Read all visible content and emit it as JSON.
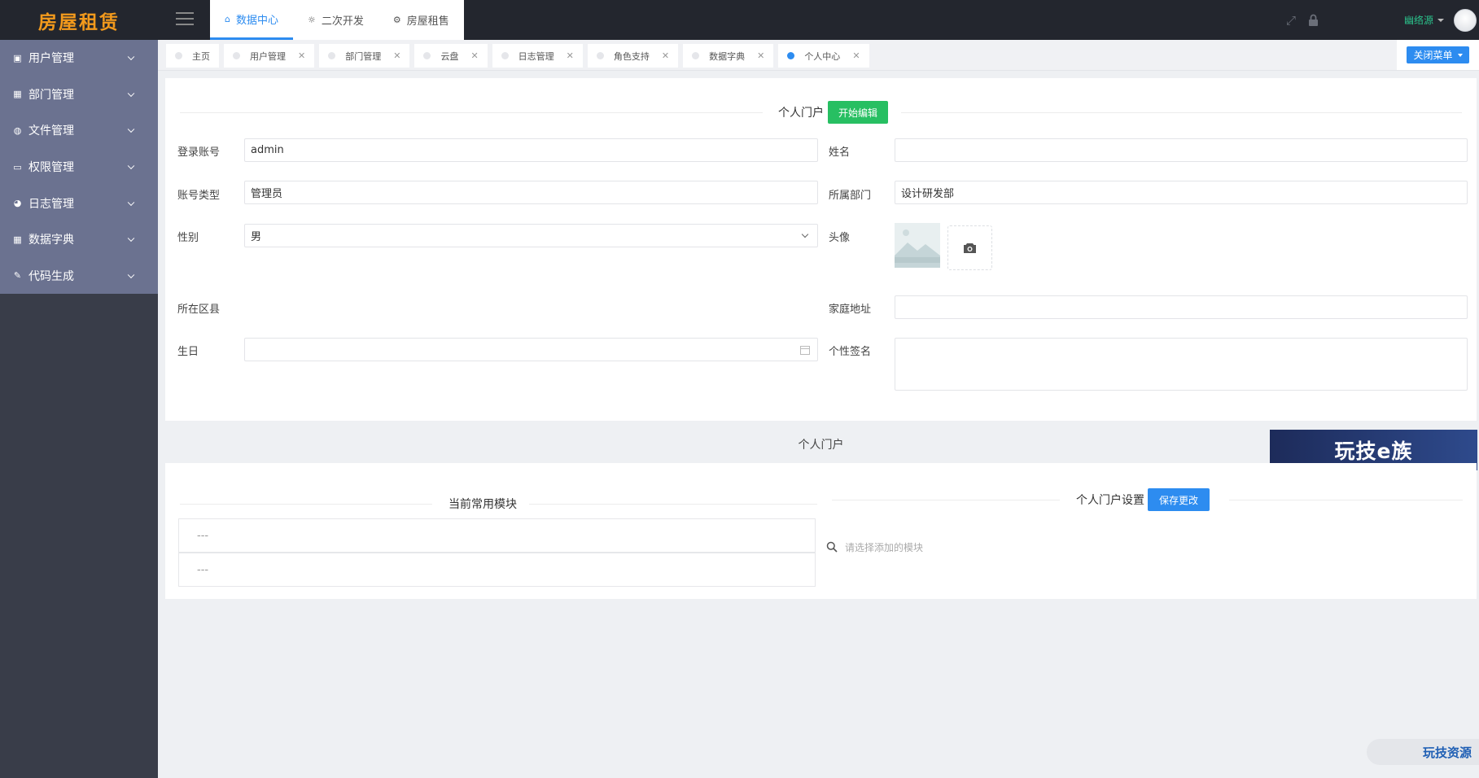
{
  "app": {
    "logo_text": "房屋租赁"
  },
  "sidebar": {
    "items": [
      {
        "label": "用户管理",
        "icon": "image-icon"
      },
      {
        "label": "部门管理",
        "icon": "grid-icon"
      },
      {
        "label": "文件管理",
        "icon": "globe-icon"
      },
      {
        "label": "权限管理",
        "icon": "monitor-icon"
      },
      {
        "label": "日志管理",
        "icon": "pie-icon"
      },
      {
        "label": "数据字典",
        "icon": "grid-icon"
      },
      {
        "label": "代码生成",
        "icon": "pencil-icon"
      }
    ]
  },
  "header": {
    "topnav": [
      {
        "label": "数据中心",
        "icon": "home-icon",
        "active": true
      },
      {
        "label": "二次开发",
        "icon": "bulb-icon",
        "active": false
      },
      {
        "label": "房屋租售",
        "icon": "settings-icon",
        "active": false
      }
    ],
    "username": "幽络源"
  },
  "tabs": [
    {
      "label": "主页",
      "closable": false,
      "active": false
    },
    {
      "label": "用户管理",
      "closable": true,
      "active": false
    },
    {
      "label": "部门管理",
      "closable": true,
      "active": false
    },
    {
      "label": "云盘",
      "closable": true,
      "active": false
    },
    {
      "label": "日志管理",
      "closable": true,
      "active": false
    },
    {
      "label": "角色支持",
      "closable": true,
      "active": false
    },
    {
      "label": "数据字典",
      "closable": true,
      "active": false
    },
    {
      "label": "个人中心",
      "closable": true,
      "active": true
    }
  ],
  "close_menu_label": "关闭菜单",
  "profile": {
    "section_title": "个人门户",
    "edit_button": "开始编辑",
    "fields": {
      "login_label": "登录账号",
      "login_value": "admin",
      "name_label": "姓名",
      "name_value": "",
      "account_type_label": "账号类型",
      "account_type_value": "管理员",
      "dept_label": "所属部门",
      "dept_value": "设计研发部",
      "gender_label": "性别",
      "gender_value": "男",
      "avatar_label": "头像",
      "district_label": "所在区县",
      "address_label": "家庭地址",
      "address_value": "",
      "birthday_label": "生日",
      "birthday_value": "",
      "signature_label": "个性签名",
      "signature_value": ""
    }
  },
  "portal": {
    "bar_title": "个人门户",
    "banner_text": "玩技e族",
    "modules_title": "当前常用模块",
    "modules": [
      "---",
      "---"
    ],
    "settings_title": "个人门户设置",
    "save_button": "保存更改",
    "search_placeholder": "请选择添加的模块"
  },
  "watermark_text": "玩技资源"
}
